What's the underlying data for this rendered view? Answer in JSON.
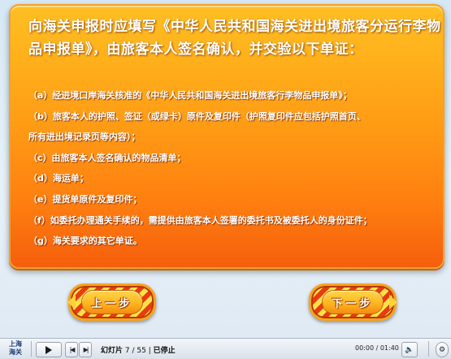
{
  "card": {
    "title": "向海关申报时应填写《中华人民共和国海关进出境旅客分运行李物品申报单》，由旅客本人签名确认，并交验以下单证：",
    "items": [
      "（a）经进境口岸海关核准的《中华人民共和国海关进出境旅客行李物品申报单》；",
      "（b）旅客本人的护照、签证（或绿卡）原件及复印件（护照复印件应包括护照首页、",
      "所有进出境记录页等内容）；",
      "（c）由旅客本人签名确认的物品清单；",
      "（d）海运单；",
      "（e）提货单原件及复印件；",
      "（f）如委托办理通关手续的，需提供由旅客本人签署的委托书及被委托人的身份证件；",
      "（g）海关要求的其它单证。"
    ]
  },
  "nav": {
    "prev_label": "上一步",
    "next_label": "下一步"
  },
  "player": {
    "logo_line1": "上海",
    "logo_line2": "海关",
    "slide_label": "幻灯片",
    "slide_current": "7",
    "slide_total": "55",
    "status": "已停止",
    "time_current": "00:00",
    "time_total": "01:40"
  },
  "icons": {
    "play": "play-icon",
    "prev_slide": "skip-back-icon",
    "next_slide": "skip-forward-icon",
    "volume": "volume-icon",
    "settings": "settings-icon"
  },
  "colors": {
    "card_top": "#ffbf24",
    "card_bottom": "#f55e0c",
    "stripe_red": "#e83b10",
    "stripe_yellow": "#ffe14a"
  }
}
